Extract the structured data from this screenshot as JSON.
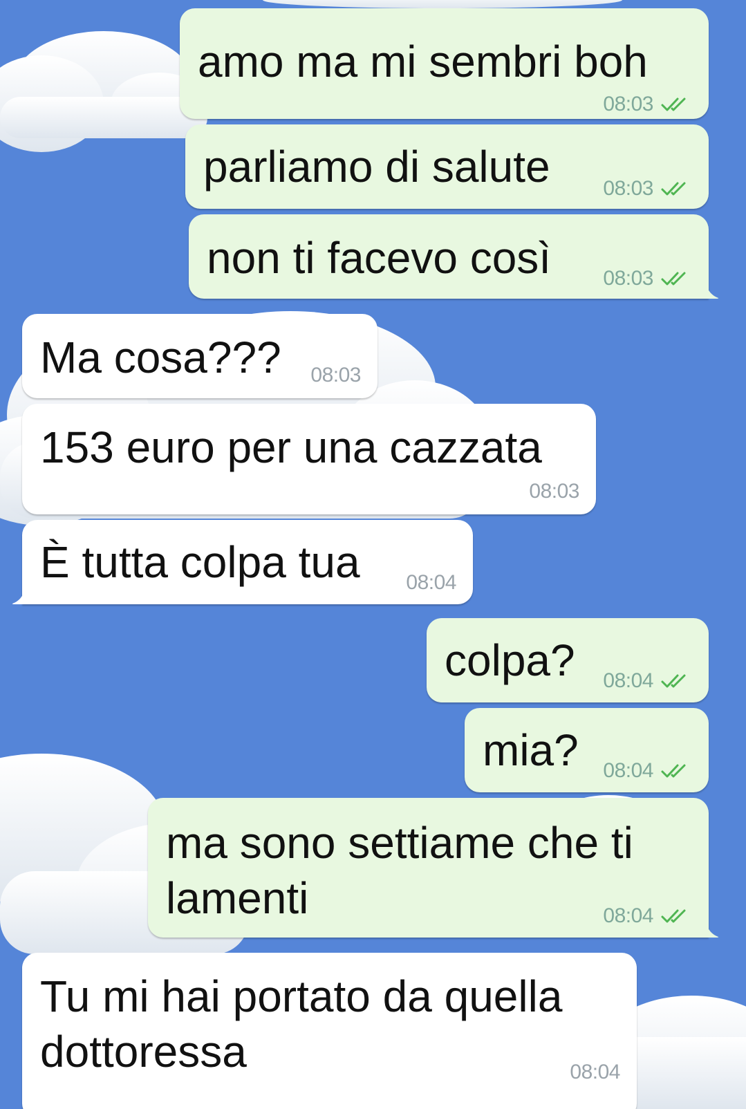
{
  "theme": {
    "wallpaper": "#5585d8",
    "bubble_out": "#e8f8e0",
    "bubble_in": "#ffffff",
    "tick_color": "#4fb552"
  },
  "messages": [
    {
      "direction": "out",
      "text": "amo ma mi sembri boh",
      "time": "08:03",
      "status": "read-double-tick-icon"
    },
    {
      "direction": "out",
      "text": "parliamo di salute",
      "time": "08:03",
      "status": "read-double-tick-icon"
    },
    {
      "direction": "out",
      "text": "non ti facevo così",
      "time": "08:03",
      "status": "read-double-tick-icon"
    },
    {
      "direction": "in",
      "text": "Ma cosa???",
      "time": "08:03"
    },
    {
      "direction": "in",
      "text": "153 euro per una cazzata",
      "time": "08:03"
    },
    {
      "direction": "in",
      "text": "È tutta colpa tua",
      "time": "08:04"
    },
    {
      "direction": "out",
      "text": "colpa?",
      "time": "08:04",
      "status": "read-double-tick-icon"
    },
    {
      "direction": "out",
      "text": "mia?",
      "time": "08:04",
      "status": "read-double-tick-icon"
    },
    {
      "direction": "out",
      "text_lines": [
        "ma sono settiame che ti",
        "lamenti"
      ],
      "time": "08:04",
      "status": "read-double-tick-icon"
    },
    {
      "direction": "in",
      "text_lines": [
        "Tu mi hai portato da quella",
        "dottoressa"
      ],
      "time": "08:04"
    }
  ]
}
